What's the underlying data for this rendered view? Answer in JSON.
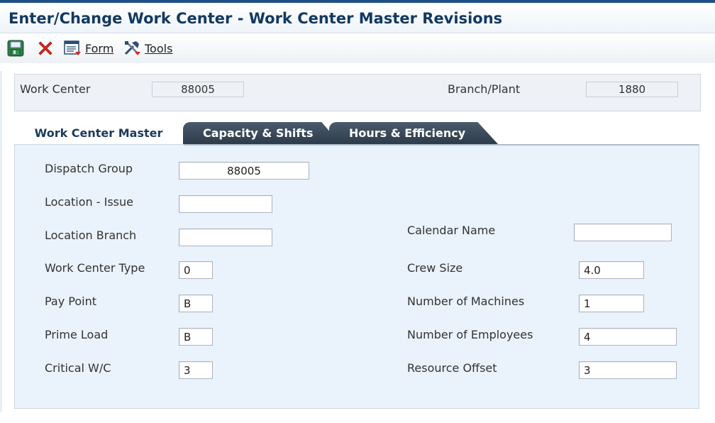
{
  "window": {
    "title": "Enter/Change Work Center - Work Center Master Revisions"
  },
  "toolbar": {
    "save_icon": "save-icon",
    "cancel_icon": "close-icon",
    "form": {
      "label": "Form",
      "icon": "form-menu-icon"
    },
    "tools": {
      "label": "Tools",
      "icon": "tools-menu-icon"
    }
  },
  "header": {
    "work_center": {
      "label": "Work Center",
      "value": "88005"
    },
    "branch_plant": {
      "label": "Branch/Plant",
      "value": "1880"
    }
  },
  "tabs": [
    {
      "label": "Work Center Master",
      "active": true
    },
    {
      "label": "Capacity & Shifts",
      "active": false
    },
    {
      "label": "Hours & Efficiency",
      "active": false
    }
  ],
  "form": {
    "dispatch_group": {
      "label": "Dispatch Group",
      "value": "88005"
    },
    "location_issue": {
      "label": "Location - Issue",
      "value": ""
    },
    "location_branch": {
      "label": "Location Branch",
      "value": ""
    },
    "work_center_type": {
      "label": "Work Center Type",
      "value": "0"
    },
    "pay_point": {
      "label": "Pay Point",
      "value": "B"
    },
    "prime_load": {
      "label": "Prime Load",
      "value": "B"
    },
    "critical_wc": {
      "label": "Critical W/C",
      "value": "3"
    },
    "calendar_name": {
      "label": "Calendar Name",
      "value": ""
    },
    "crew_size": {
      "label": "Crew Size",
      "value": "4.0"
    },
    "number_of_machines": {
      "label": "Number of Machines",
      "value": "1"
    },
    "number_of_employees": {
      "label": "Number of Employees",
      "value": "4"
    },
    "resource_offset": {
      "label": "Resource Offset",
      "value": "3"
    }
  },
  "colors": {
    "title_text": "#12395f",
    "tab_inactive_bg": "#3a4857",
    "panel_bg": "#eaf2fb"
  }
}
